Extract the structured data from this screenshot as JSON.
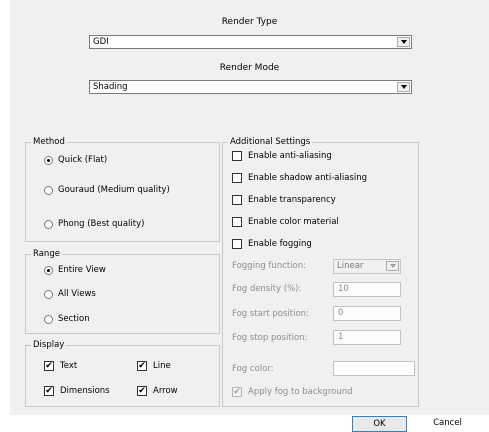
{
  "render_type": {
    "label": "Render Type",
    "value": "GDI"
  },
  "render_mode": {
    "label": "Render Mode",
    "value": "Shading"
  },
  "method": {
    "title": "Method",
    "options": [
      {
        "label": "Quick (Flat)",
        "selected": true
      },
      {
        "label": "Gouraud (Medium quality)",
        "selected": false
      },
      {
        "label": "Phong (Best quality)",
        "selected": false
      }
    ]
  },
  "range": {
    "title": "Range",
    "options": [
      {
        "label": "Entire View",
        "selected": true
      },
      {
        "label": "All Views",
        "selected": false
      },
      {
        "label": "Section",
        "selected": false
      }
    ]
  },
  "display": {
    "title": "Display",
    "items": [
      {
        "label": "Text",
        "checked": true
      },
      {
        "label": "Line",
        "checked": true
      },
      {
        "label": "Dimensions",
        "checked": true
      },
      {
        "label": "Arrow",
        "checked": true
      }
    ]
  },
  "additional": {
    "title": "Additional Settings",
    "checkboxes": [
      {
        "label": "Enable anti-aliasing",
        "checked": false
      },
      {
        "label": "Enable shadow anti-aliasing",
        "checked": false
      },
      {
        "label": "Enable transparency",
        "checked": false
      },
      {
        "label": "Enable color material",
        "checked": false
      },
      {
        "label": "Enable fogging",
        "checked": false
      }
    ],
    "fog_function": {
      "label": "Fogging function:",
      "value": "Linear"
    },
    "fog_density": {
      "label": "Fog density (%):",
      "value": "10"
    },
    "fog_start": {
      "label": "Fog start position:",
      "value": "0"
    },
    "fog_stop": {
      "label": "Fog stop position:",
      "value": "1"
    },
    "fog_color": {
      "label": "Fog color:",
      "value": ""
    },
    "apply_fog": {
      "label": "Apply fog to background",
      "checked": true
    }
  },
  "buttons": {
    "ok": "OK",
    "cancel": "Cancel"
  }
}
